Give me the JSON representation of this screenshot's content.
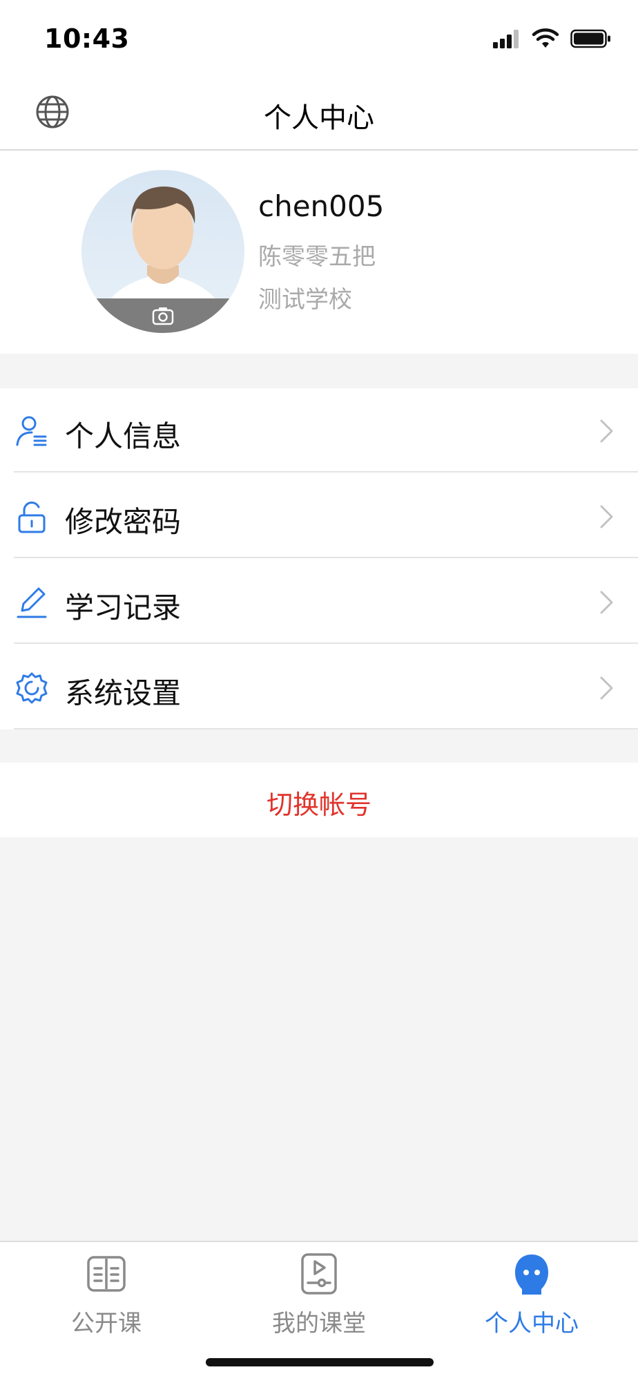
{
  "status_bar": {
    "time": "10:43"
  },
  "header": {
    "title": "个人中心",
    "left_icon": "globe-icon"
  },
  "profile": {
    "username": "chen005",
    "real_name": "陈零零五把",
    "school": "测试学校",
    "avatar_icon": "camera-icon"
  },
  "menu": {
    "items": [
      {
        "label": "个人信息",
        "icon": "user-list-icon"
      },
      {
        "label": "修改密码",
        "icon": "unlock-icon"
      },
      {
        "label": "学习记录",
        "icon": "pen-icon"
      },
      {
        "label": "系统设置",
        "icon": "gear-icon"
      }
    ]
  },
  "switch_account": {
    "label": "切换帐号"
  },
  "tabs": {
    "items": [
      {
        "label": "公开课",
        "icon": "book-icon",
        "active": false
      },
      {
        "label": "我的课堂",
        "icon": "video-classroom-icon",
        "active": false
      },
      {
        "label": "个人中心",
        "icon": "person-icon",
        "active": true
      }
    ]
  },
  "colors": {
    "accent": "#2e7be6",
    "danger": "#e0342c",
    "secondary_text": "#a9a9a9",
    "background": "#f4f4f4"
  }
}
